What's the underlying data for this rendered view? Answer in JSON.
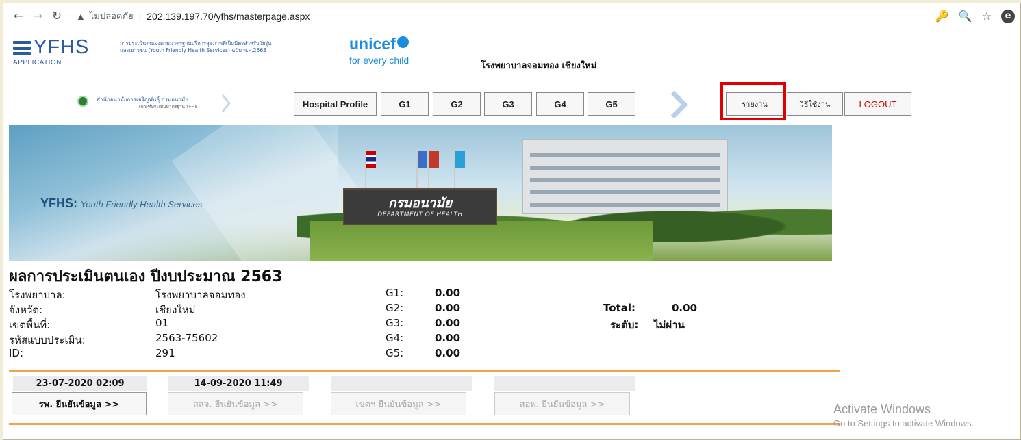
{
  "browser": {
    "security_label": "ไม่ปลอดภัย",
    "url": "202.139.197.70/yfhs/masterpage.aspx",
    "profile_initial": "e"
  },
  "header": {
    "logo_word": "YFHS",
    "logo_sub": "APPLICATION",
    "logo_desc_1": "การประเมินตนเองตามมาตรฐานบริการสุขภาพที่เป็นมิตรสำหรับวัยรุ่น",
    "logo_desc_2": "และเยาวชน (Youth Friendly Health Services) ฉบับ พ.ศ.2563",
    "unicef_word": "unicef",
    "unicef_tag": "for every child",
    "hospital_title": "โรงพยาบาลจอมทอง เชียงใหม่",
    "dept_line1": "สำนักอนามัยการเจริญพันธุ์ กรมอนามัย",
    "dept_line2": "เกณฑ์ประเมินมาตรฐาน YFHS"
  },
  "menu": {
    "hospital_profile": "Hospital Profile",
    "g1": "G1",
    "g2": "G2",
    "g3": "G3",
    "g4": "G4",
    "g5": "G5",
    "report": "รายงาน",
    "manual": "วิธีใช้งาน",
    "logout": "LOGOUT"
  },
  "banner": {
    "tag_bold": "YFHS:",
    "tag_rest": "Youth Friendly Health Services",
    "sign_th": "กรมอนามัย",
    "sign_en": "DEPARTMENT OF HEALTH"
  },
  "summary": {
    "title": "ผลการประเมินตนเอง ปีงบประมาณ 2563",
    "fields": [
      {
        "label": "โรงพยาบาล:",
        "value": "โรงพยาบาลจอมทอง"
      },
      {
        "label": "จังหวัด:",
        "value": "เชียงใหม่"
      },
      {
        "label": "เขตพื้นที่:",
        "value": "01"
      },
      {
        "label": "รหัสแบบประเมิน:",
        "value": "2563-75602"
      },
      {
        "label": "ID:",
        "value": "291"
      }
    ],
    "scores": [
      {
        "label": "G1:",
        "value": "0.00"
      },
      {
        "label": "G2:",
        "value": "0.00"
      },
      {
        "label": "G3:",
        "value": "0.00"
      },
      {
        "label": "G4:",
        "value": "0.00"
      },
      {
        "label": "G5:",
        "value": "0.00"
      }
    ],
    "total_label": "Total:",
    "total_value": "0.00",
    "level_label": "ระดับ:",
    "level_value": "ไม่ผ่าน"
  },
  "confirm": [
    {
      "date": "23-07-2020 02:09",
      "button": "รพ. ยืนยันข้อมูล >>"
    },
    {
      "date": "14-09-2020 11:49",
      "button": "สสจ. ยืนยันข้อมูล >>"
    },
    {
      "date": "",
      "button": "เขตฯ ยืนยันข้อมูล >>"
    },
    {
      "date": "",
      "button": "สอพ. ยืนยันข้อมูล >>"
    }
  ],
  "watermark": {
    "line1": "Activate Windows",
    "line2": "Go to Settings to activate Windows."
  },
  "colors": {
    "brand_blue": "#2a5aa0",
    "unicef_blue": "#1a8de0",
    "highlight_red": "#e00000",
    "logout_red": "#cc0000",
    "rule_orange": "#f5a04a"
  }
}
